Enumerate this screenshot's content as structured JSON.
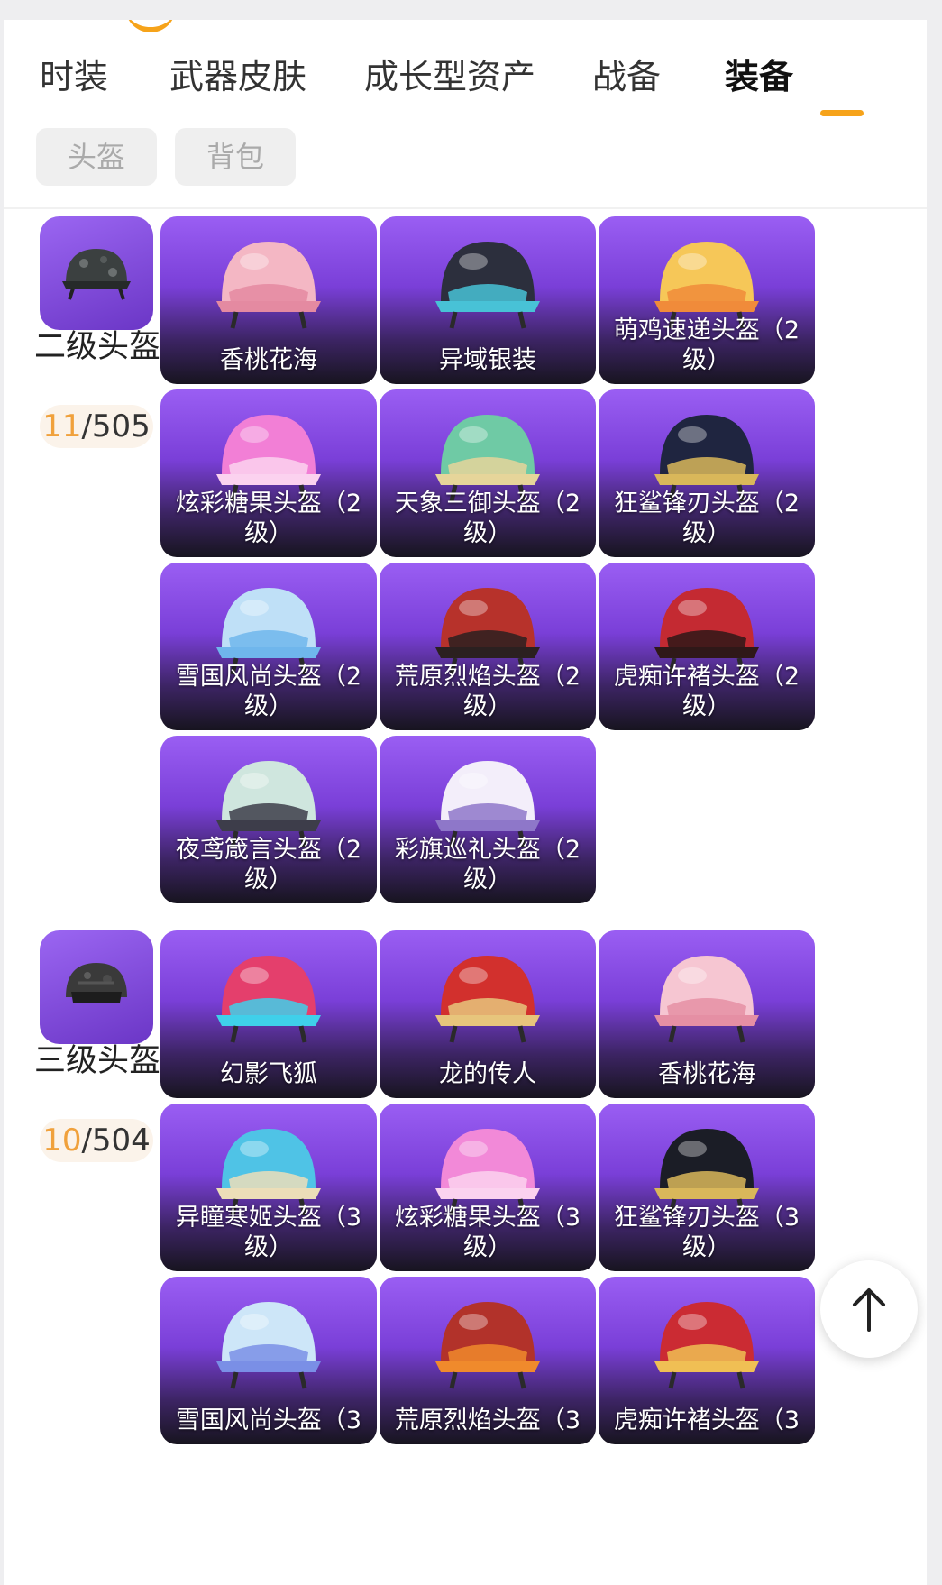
{
  "tabs": [
    {
      "label": "时装"
    },
    {
      "label": "武器皮肤"
    },
    {
      "label": "成长型资产"
    },
    {
      "label": "战备"
    },
    {
      "label": "装备",
      "active": true
    }
  ],
  "subtabs": [
    {
      "label": "头盔"
    },
    {
      "label": "背包"
    }
  ],
  "categories": [
    {
      "name": "二级头盔",
      "owned": "11",
      "total": "/505",
      "items": [
        {
          "label": "香桃花海",
          "color": "#f4b7c4",
          "accent": "#e48aa1"
        },
        {
          "label": "异域银装",
          "color": "#2c2f3d",
          "accent": "#48c2d6"
        },
        {
          "label": "萌鸡速递头盔（2级）",
          "color": "#f6c758",
          "accent": "#f08b3a"
        },
        {
          "label": "炫彩糖果头盔（2级）",
          "color": "#f27fd6",
          "accent": "#fbd2ef"
        },
        {
          "label": "天象三御头盔（2级）",
          "color": "#6fcaa5",
          "accent": "#e6d59a"
        },
        {
          "label": "狂鲨锋刃头盔（2级）",
          "color": "#1f2540",
          "accent": "#d9b75a"
        },
        {
          "label": "雪国风尚头盔（2级）",
          "color": "#bfe0f7",
          "accent": "#6fb6ec"
        },
        {
          "label": "荒原烈焰头盔（2级）",
          "color": "#b7322b",
          "accent": "#2b2020"
        },
        {
          "label": "虎痴许褚头盔（2级）",
          "color": "#c42a32",
          "accent": "#2f1818"
        },
        {
          "label": "夜鸢箴言头盔（2级）",
          "color": "#cfe6de",
          "accent": "#3d3d4a"
        },
        {
          "label": "彩旗巡礼头盔（2级）",
          "color": "#f3eefa",
          "accent": "#8e77c9"
        }
      ]
    },
    {
      "name": "三级头盔",
      "owned": "10",
      "total": "/504",
      "items": [
        {
          "label": "幻影飞狐",
          "color": "#e43f6c",
          "accent": "#3fd0ea"
        },
        {
          "label": "龙的传人",
          "color": "#d2302d",
          "accent": "#e7c57c"
        },
        {
          "label": "香桃花海",
          "color": "#f6c6d2",
          "accent": "#e58fa4"
        },
        {
          "label": "异瞳寒姬头盔（3级）",
          "color": "#4fc3e6",
          "accent": "#ecdeb8"
        },
        {
          "label": "炫彩糖果头盔（3级）",
          "color": "#f289d8",
          "accent": "#fbd2ef"
        },
        {
          "label": "狂鲨锋刃头盔（3级）",
          "color": "#1b1d26",
          "accent": "#d9b75a"
        },
        {
          "label": "雪国风尚头盔（3",
          "color": "#cde6f8",
          "accent": "#7a8fe6"
        },
        {
          "label": "荒原烈焰头盔（3",
          "color": "#b2322a",
          "accent": "#f08a2c"
        },
        {
          "label": "虎痴许褚头盔（3",
          "color": "#cb2b33",
          "accent": "#f0bf54"
        }
      ]
    }
  ]
}
